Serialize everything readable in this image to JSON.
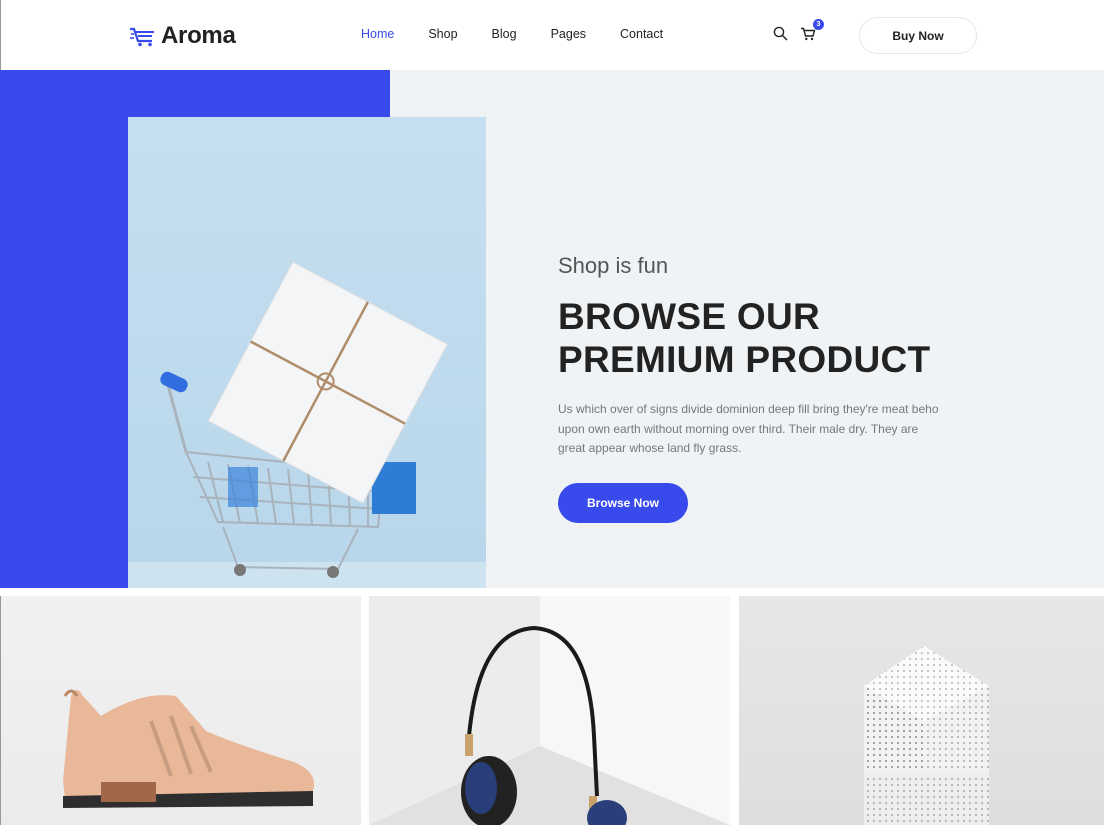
{
  "brand": {
    "name": "Aroma",
    "accent": "#384aeb"
  },
  "nav": {
    "items": [
      {
        "label": "Home",
        "active": true
      },
      {
        "label": "Shop",
        "active": false
      },
      {
        "label": "Blog",
        "active": false
      },
      {
        "label": "Pages",
        "active": false
      },
      {
        "label": "Contact",
        "active": false
      }
    ]
  },
  "header": {
    "search_icon": "search-icon",
    "cart_icon": "cart-icon",
    "cart_count": "3",
    "buy_label": "Buy Now"
  },
  "hero": {
    "subtitle": "Shop is fun",
    "title_line1": "BROWSE OUR",
    "title_line2": "PREMIUM PRODUCT",
    "description": "Us which over of signs divide dominion deep fill bring they're meat beho upon own earth without morning over third. Their male dry. They are great appear whose land fly grass.",
    "button_label": "Browse Now"
  },
  "products": [
    {
      "name": "sneaker-image"
    },
    {
      "name": "headphones-image"
    },
    {
      "name": "speaker-image"
    }
  ]
}
